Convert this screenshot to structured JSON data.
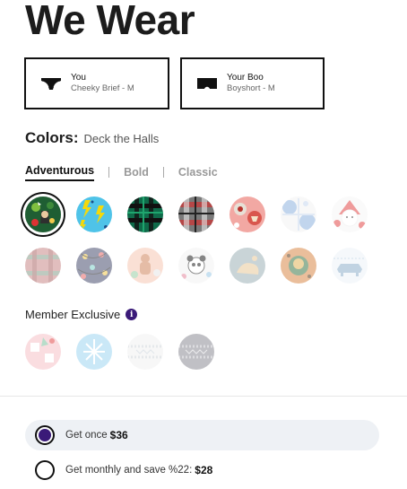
{
  "page": {
    "title": "We Wear"
  },
  "wearers": [
    {
      "who": "You",
      "style": "Cheeky Brief - M",
      "icon": "brief-icon"
    },
    {
      "who": "Your Boo",
      "style": "Boyshort - M",
      "icon": "boyshort-icon"
    }
  ],
  "colors": {
    "label": "Colors:",
    "selected_name": "Deck the Halls"
  },
  "tabs": [
    {
      "label": "Adventurous",
      "active": true
    },
    {
      "label": "Bold",
      "active": false
    },
    {
      "label": "Classic",
      "active": false
    }
  ],
  "swatches": {
    "row1": [
      "deck-the-halls",
      "lightning-bolts",
      "green-plaid",
      "gray-plaid",
      "pink-print",
      "blue-snowflake",
      "santa"
    ],
    "row2": [
      "red-plaid",
      "navy-lights",
      "peach-gingerbread",
      "panda",
      "slate-fox",
      "cheetah-gold",
      "polar-bear"
    ],
    "member": [
      "pink-candy",
      "blue-snow",
      "white-knit",
      "gray-knit"
    ]
  },
  "member_exclusive": {
    "label": "Member Exclusive",
    "info_icon": "info-icon"
  },
  "purchase_options": [
    {
      "label": "Get once",
      "price": "$36",
      "selected": true
    },
    {
      "label": "Get monthly and save %22:",
      "price": "$28",
      "selected": false
    }
  ],
  "colors_brand": {
    "accent": "#3a1a78",
    "selected_option_bg": "#eef1f5"
  }
}
